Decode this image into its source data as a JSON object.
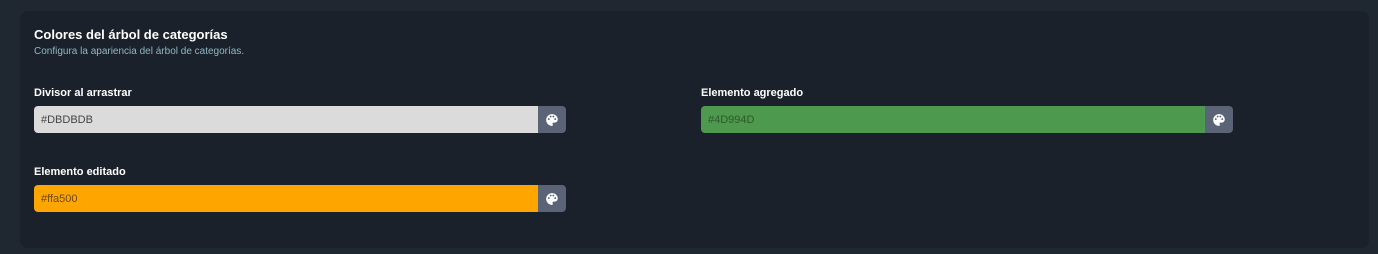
{
  "section": {
    "title": "Colores del árbol de categorías",
    "subtitle": "Configura la apariencia del árbol de categorías."
  },
  "fields": [
    {
      "label": "Divisor al arrastrar",
      "value": "#DBDBDB",
      "bg": "#dbdbdb",
      "text_color": "#444444",
      "icon": "palette-icon"
    },
    {
      "label": "Elemento agregado",
      "value": "#4D994D",
      "bg": "#4d994d",
      "text_color": "#2d5a2d",
      "icon": "palette-icon"
    },
    {
      "label": "Elemento editado",
      "value": "#ffa500",
      "bg": "#ffa500",
      "text_color": "#6b4a10",
      "icon": "palette-icon"
    }
  ],
  "colors": {
    "card_bg": "#1b212a",
    "page_bg": "#1f2731",
    "picker_bg": "#5b6476"
  }
}
